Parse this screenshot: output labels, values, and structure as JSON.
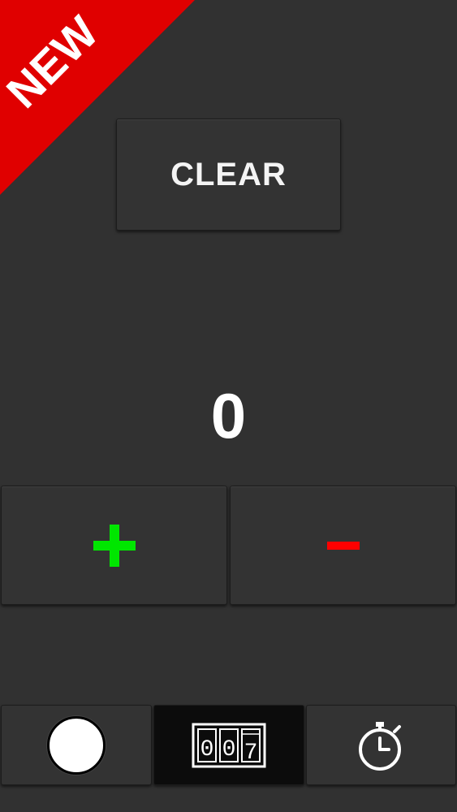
{
  "ribbon": {
    "label": "NEW",
    "color": "#e00000"
  },
  "clear_button": {
    "label": "CLEAR"
  },
  "counter": {
    "value": "0"
  },
  "controls": {
    "increment_icon": "plus-icon",
    "decrement_icon": "minus-icon",
    "increment_color": "#00e600",
    "decrement_color": "#ff0000"
  },
  "tabs": [
    {
      "icon": "circle-icon",
      "selected": false
    },
    {
      "icon": "counter-digits-icon",
      "selected": true,
      "digits": [
        "0",
        "0",
        "7"
      ]
    },
    {
      "icon": "stopwatch-icon",
      "selected": false
    }
  ]
}
